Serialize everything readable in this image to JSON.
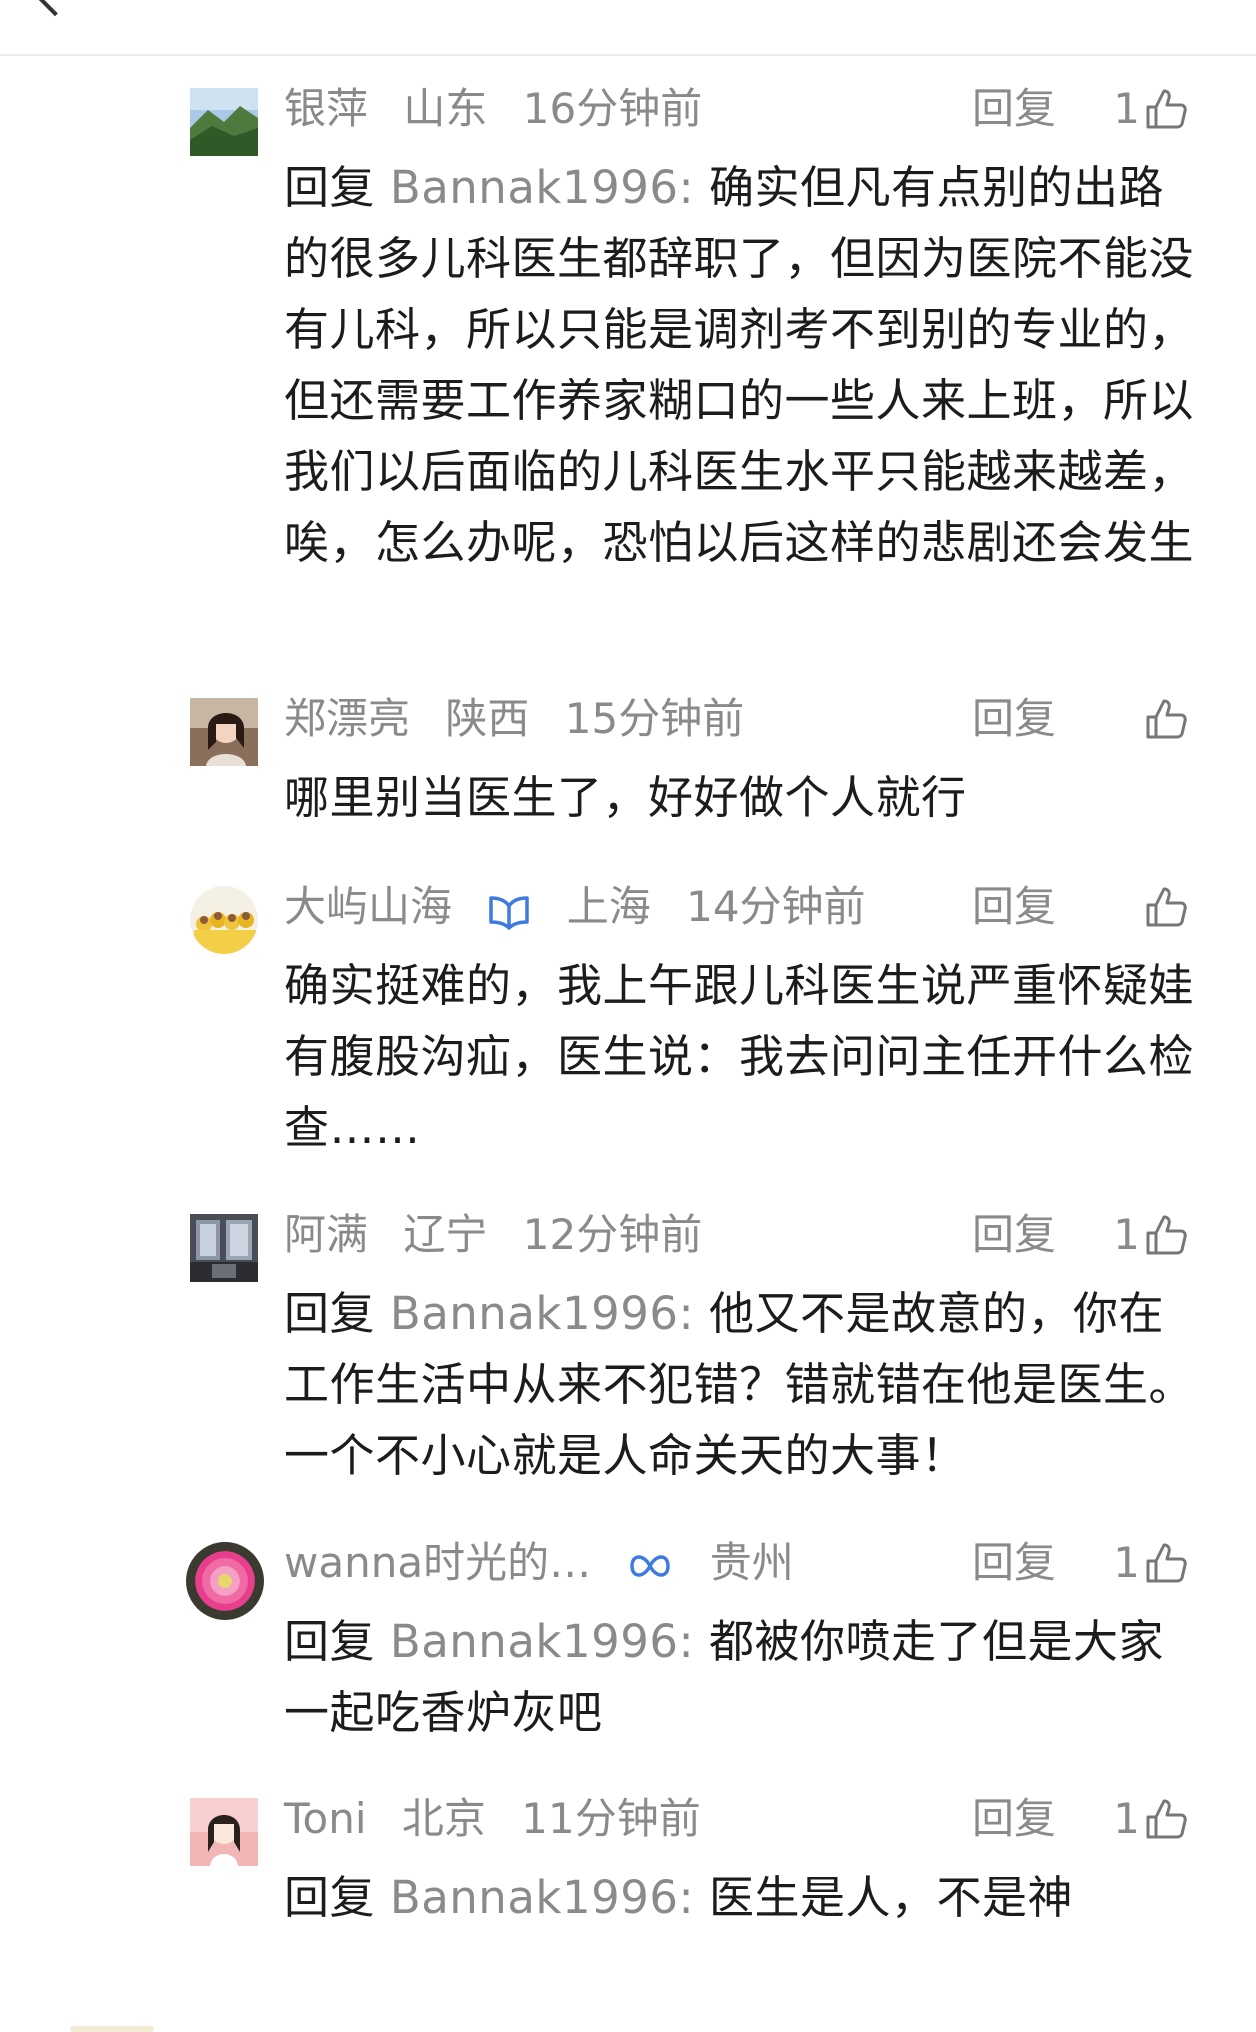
{
  "comments": [
    {
      "username": "银萍",
      "location": "山东",
      "time": "16分钟前",
      "reply_label": "回复",
      "likes": "1",
      "reply_prefix": "回复",
      "reply_target": "Bannak1996:",
      "text": "确实但凡有点别的出路的很多儿科医生都辞职了，但因为医院不能没有儿科，所以只能是调剂考不到别的专业的，但还需要工作养家糊口的一些人来上班，所以我们以后面临的儿科医生水平只能越来越差，唉，怎么办呢，恐怕以后这样的悲剧还会发生"
    },
    {
      "username": "郑漂亮",
      "location": "陕西",
      "time": "15分钟前",
      "reply_label": "回复",
      "likes": "",
      "reply_prefix": "",
      "reply_target": "",
      "text": "哪里别当医生了，好好做个人就行"
    },
    {
      "username": "大屿山海",
      "location": "上海",
      "time": "14分钟前",
      "reply_label": "回复",
      "likes": "",
      "reply_prefix": "",
      "reply_target": "",
      "text": "确实挺难的，我上午跟儿科医生说严重怀疑娃有腹股沟疝，医生说：我去问问主任开什么检查……"
    },
    {
      "username": "阿满",
      "location": "辽宁",
      "time": "12分钟前",
      "reply_label": "回复",
      "likes": "1",
      "reply_prefix": "回复",
      "reply_target": "Bannak1996:",
      "text": "他又不是故意的，你在工作生活中从来不犯错？错就错在他是医生。一个不小心就是人命关天的大事！"
    },
    {
      "username": "wanna时光的…",
      "location": "贵州",
      "time": "",
      "reply_label": "回复",
      "likes": "1",
      "reply_prefix": "回复",
      "reply_target": "Bannak1996:",
      "text": "都被你喷走了但是大家一起吃香炉灰吧"
    },
    {
      "username": "Toni",
      "location": "北京",
      "time": "11分钟前",
      "reply_label": "回复",
      "likes": "1",
      "reply_prefix": "回复",
      "reply_target": "Bannak1996:",
      "text": "医生是人，不是神"
    }
  ],
  "icons": {
    "back": "chevron-left-icon",
    "like": "thumbs-up-icon",
    "book_badge": "book-badge-icon",
    "infinity_badge": "infinity-badge-icon"
  },
  "colors": {
    "meta_gray": "#8a8a8a",
    "text": "#1c1c1c",
    "badge_blue": "#3d7be0"
  }
}
